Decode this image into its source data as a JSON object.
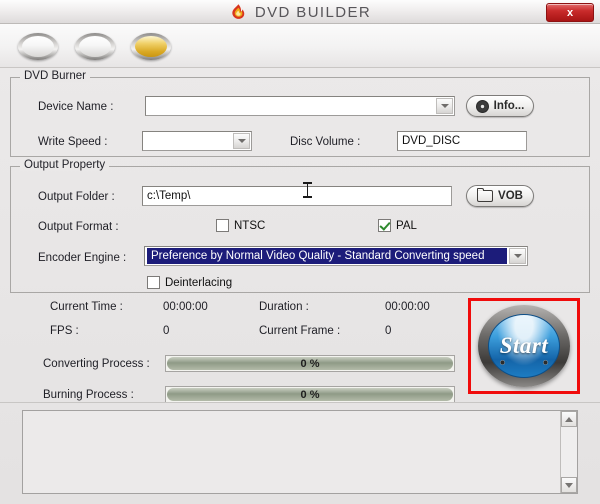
{
  "window": {
    "title": "DVD BUILDER",
    "app_icon": "flame-icon",
    "close_label": "x"
  },
  "toolbar": {
    "buttons": [
      {
        "name": "toolbar-button-1",
        "style": "silver",
        "label": ""
      },
      {
        "name": "toolbar-button-2",
        "style": "silver",
        "label": ""
      },
      {
        "name": "toolbar-button-3",
        "style": "gold",
        "label": ""
      }
    ]
  },
  "burner": {
    "legend": "DVD Burner",
    "device_name_label": "Device Name :",
    "device_name_value": "",
    "write_speed_label": "Write Speed :",
    "write_speed_value": "",
    "disc_volume_label": "Disc Volume :",
    "disc_volume_value": "DVD_DISC",
    "info_button_label": "Info..."
  },
  "output": {
    "legend": "Output Property",
    "output_folder_label": "Output Folder :",
    "output_folder_value": "c:\\Temp\\",
    "vob_button_label": "VOB",
    "output_format_label": "Output Format :",
    "ntsc_label": "NTSC",
    "ntsc_checked": false,
    "pal_label": "PAL",
    "pal_checked": true,
    "encoder_engine_label": "Encoder Engine :",
    "encoder_engine_value": "Preference by Normal Video Quality - Standard Converting speed",
    "deinterlacing_label": "Deinterlacing",
    "deinterlacing_checked": false
  },
  "status": {
    "current_time_label": "Current Time :",
    "current_time_value": "00:00:00",
    "duration_label": "Duration :",
    "duration_value": "00:00:00",
    "fps_label": "FPS :",
    "fps_value": "0",
    "current_frame_label": "Current Frame :",
    "current_frame_value": "0",
    "converting_process_label": "Converting Process :",
    "converting_process_value": "0 %",
    "burning_process_label": "Burning Process :",
    "burning_process_value": "0 %"
  },
  "start": {
    "label": "Start",
    "highlighted": true,
    "highlight_color": "#f00b0b"
  },
  "log": {
    "text": ""
  },
  "colors": {
    "panel": "#eae8e8",
    "selection_blue": "#1c1c7a",
    "progress_fill": "#8f9a86",
    "start_blue": "#1464a8",
    "close_red": "#c92b2b",
    "check_green": "#2f8a2f"
  }
}
